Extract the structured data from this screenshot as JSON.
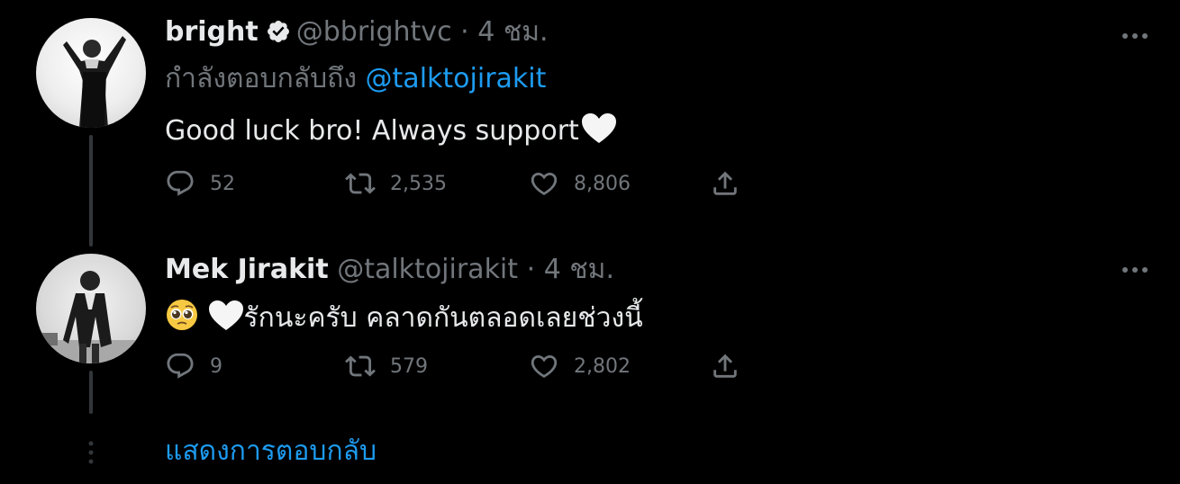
{
  "colors": {
    "background": "#000000",
    "text_primary": "#e7e9ea",
    "text_secondary": "#71767b",
    "link": "#1d9bf0",
    "verified_badge": "#e7e9ea"
  },
  "tweets": [
    {
      "name": "bright",
      "verified": true,
      "handle": "@bbrightvc",
      "separator": "·",
      "time": "4 ชม.",
      "reply_to_prefix": "กำลังตอบกลับถึง",
      "reply_to_mention": "@talktojirakit",
      "text": "Good luck bro! Always support",
      "text_emoji": "white-heart-icon",
      "actions": {
        "reply_count": "52",
        "retweet_count": "2,535",
        "like_count": "8,806"
      }
    },
    {
      "name": "Mek Jirakit",
      "verified": false,
      "handle": "@talktojirakit",
      "separator": "·",
      "time": "4 ชม.",
      "text_emoji_prefix": [
        "pleading-face-icon",
        "white-heart-icon"
      ],
      "text": "รักนะครับ คลาดกันตลอดเลยช่วงนี้",
      "actions": {
        "reply_count": "9",
        "retweet_count": "579",
        "like_count": "2,802"
      }
    }
  ],
  "show_replies": {
    "label": "แสดงการตอบกลับ"
  },
  "icons": {
    "more": "more-horizontal-icon",
    "reply": "reply-icon",
    "retweet": "retweet-icon",
    "like": "heart-outline-icon",
    "share": "share-icon",
    "thread_more": "vertical-dots-icon"
  }
}
